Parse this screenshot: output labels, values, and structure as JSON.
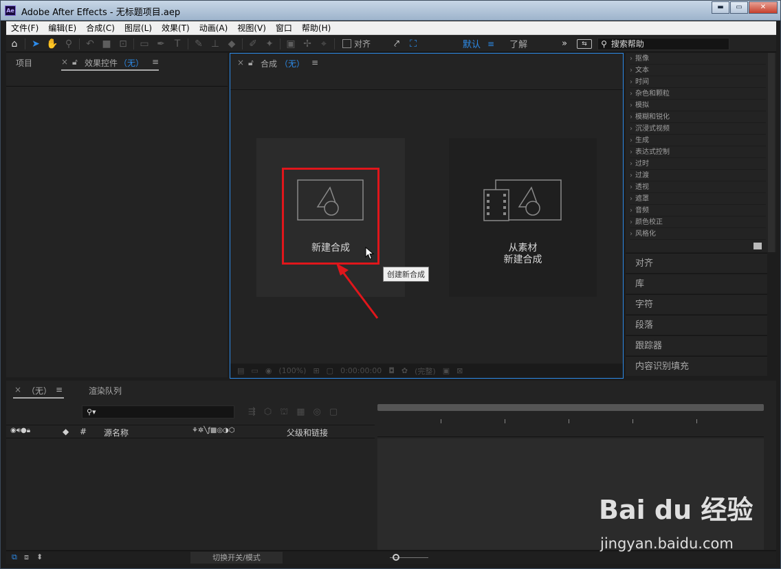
{
  "window": {
    "app_icon": "Ae",
    "title": "Adobe After Effects - 无标题项目.aep",
    "minimize": "▬",
    "maximize": "▭",
    "close": "✕"
  },
  "menu": [
    "文件(F)",
    "编辑(E)",
    "合成(C)",
    "图层(L)",
    "效果(T)",
    "动画(A)",
    "视图(V)",
    "窗口",
    "帮助(H)"
  ],
  "toolbar": {
    "align_label": "对齐",
    "workspace": "默认",
    "workspace_menu": "≡",
    "learn": "了解",
    "more": "»",
    "search_placeholder": "搜索帮助"
  },
  "project_panel": {
    "tab_project": "项目",
    "tab_effects_prefix": "效果控件",
    "tab_effects_value": "（无）",
    "menu": "≡",
    "close": "×"
  },
  "comp_panel": {
    "tab_label": "合成",
    "tab_value": "（无）",
    "menu": "≡",
    "close": "×",
    "card_new": "新建合成",
    "card_from_footage_line1": "从素材",
    "card_from_footage_line2": "新建合成",
    "tooltip": "创建新合成",
    "footer_zoom": "(100%)",
    "footer_time": "0:00:00:00",
    "footer_quality": "(完整)"
  },
  "effects_list": [
    "抠像",
    "文本",
    "时间",
    "杂色和颗粒",
    "模拟",
    "模糊和锐化",
    "沉浸式视频",
    "生成",
    "表达式控制",
    "过时",
    "过渡",
    "透视",
    "遮罩",
    "音频",
    "颜色校正",
    "风格化"
  ],
  "side_panels": [
    "对齐",
    "库",
    "字符",
    "段落",
    "跟踪器",
    "内容识别填充"
  ],
  "timeline": {
    "tab_comp": "（无）",
    "tab_render": "渲染队列",
    "menu": "≡",
    "close": "×",
    "search_icon": "⚲▾",
    "col_hash": "#",
    "col_source": "源名称",
    "col_parent": "父级和链接",
    "toggle_modes": "切换开关/模式"
  },
  "watermark": {
    "logo": "Bai du 经验",
    "url": "jingyan.baidu.com"
  },
  "colors": {
    "accent": "#2d8ceb",
    "highlight": "#e0161b"
  }
}
